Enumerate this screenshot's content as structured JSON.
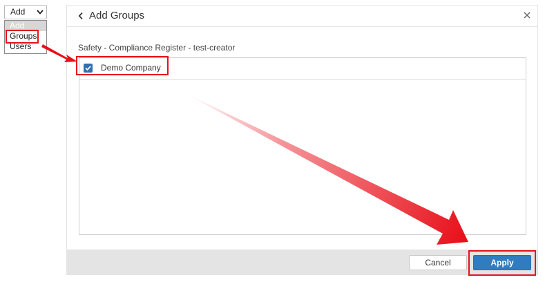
{
  "dropdown": {
    "selected": "Add",
    "options": [
      "Add",
      "Groups",
      "Users"
    ]
  },
  "modal": {
    "title": "Add Groups",
    "subtitle": "Safety - Compliance Register - test-creator",
    "rows": [
      {
        "label": "Demo Company",
        "checked": true
      }
    ],
    "cancel_label": "Cancel",
    "apply_label": "Apply"
  },
  "colors": {
    "accent": "#2f7cc0",
    "highlight": "#e8101a",
    "footer": "#e4e4e4"
  },
  "icons": [
    "chevron-down-icon",
    "back-chevron-icon",
    "close-icon",
    "checkmark-icon"
  ]
}
